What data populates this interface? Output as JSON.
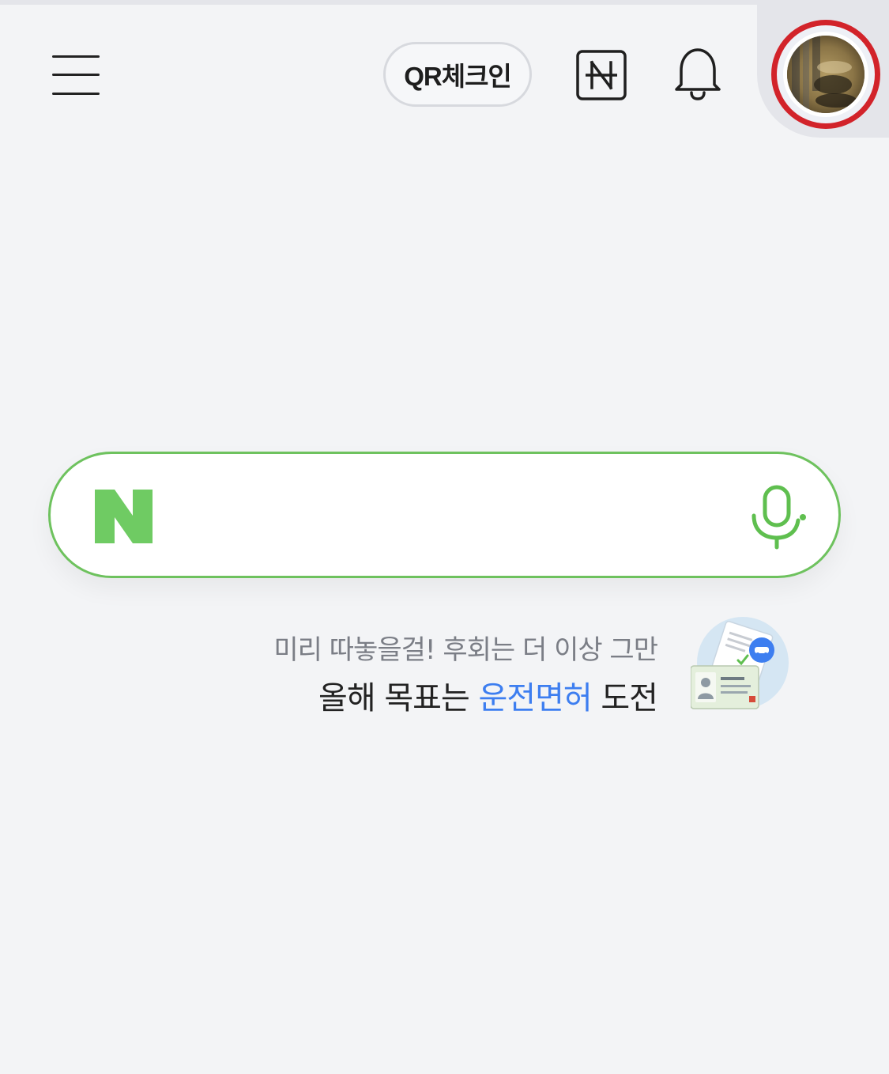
{
  "header": {
    "qr_checkin_label": "QR체크인",
    "menu_icon": "hamburger-menu-icon",
    "pay_icon": "naver-pay-icon",
    "bell_icon": "bell-icon",
    "avatar_icon": "profile-avatar"
  },
  "search": {
    "placeholder": "",
    "logo_icon": "naver-n-logo",
    "mic_icon": "microphone-icon"
  },
  "promo": {
    "line1": "미리 따놓을걸! 후회는 더 이상 그만",
    "line2_prefix": "올해 목표는 ",
    "line2_highlight": "운전면허",
    "line2_suffix": " 도전",
    "illustration_icon": "driver-license-icon"
  },
  "colors": {
    "background": "#f3f4f6",
    "accent_green": "#6ec25e",
    "highlight_blue": "#3d7ef0",
    "avatar_ring_red": "#d2232a"
  }
}
